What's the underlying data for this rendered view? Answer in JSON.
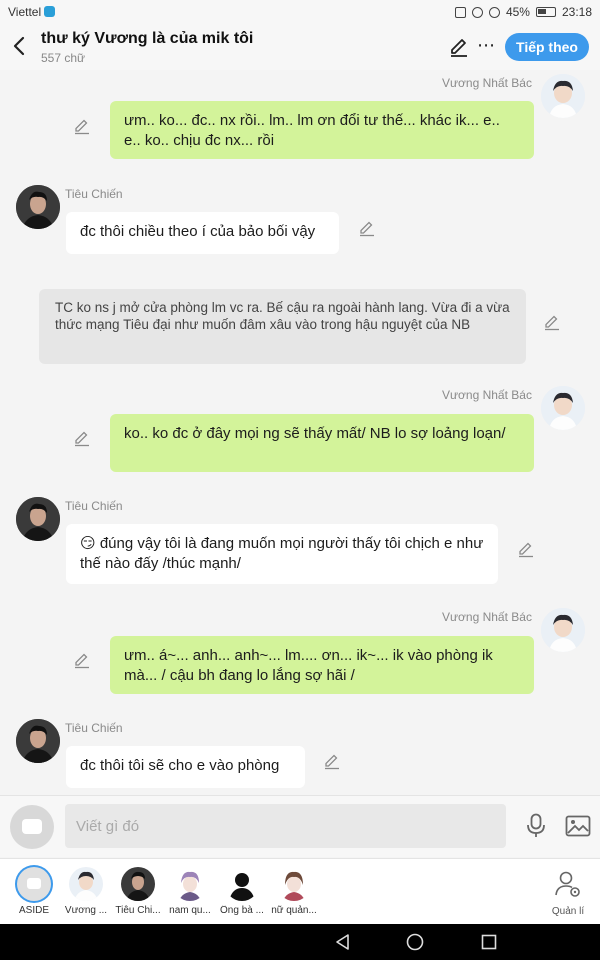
{
  "status_bar": {
    "carrier": "Viettel",
    "battery": "45%",
    "time": "23:18"
  },
  "header": {
    "title": "thư ký Vương là của mik tôi",
    "subtitle": "557 chữ",
    "next_button": "Tiếp theo"
  },
  "messages": [
    {
      "sender": "Vương Nhất Bác",
      "side": "right",
      "text": "ưm.. ko... đc.. nx rồi.. lm.. lm ơn đổi tư thế... khác ik... e.. e.. ko.. chịu đc nx... rồi"
    },
    {
      "sender": "Tiêu Chiến",
      "side": "left",
      "text": "đc thôi chiều theo í của bảo bối vậy"
    },
    {
      "sender": "",
      "side": "center",
      "text": "TC ko ns j mở cửa phòng lm vc ra. Bế cậu ra ngoài hành lang. Vừa đi a vừa thức mạng Tiêu đại như muốn đâm xâu vào trong hậu nguyệt của NB"
    },
    {
      "sender": "Vương Nhất Bác",
      "side": "right",
      "text": "ko.. ko đc ở đây mọi ng sẽ thấy mất/ NB lo sợ loảng loạn/"
    },
    {
      "sender": "Tiêu Chiến",
      "side": "left",
      "emoji": "😏",
      "text": "đúng vậy tôi là  đang muốn mọi người thấy tôi chịch e như thế nào đấy /thúc mạnh/"
    },
    {
      "sender": "Vương Nhất Bác",
      "side": "right",
      "text": "ưm.. á~... anh... anh~... lm.... ơn... ik~... ik vào phòng ik mà... / cậu bh đang lo lắng sợ hãi /"
    },
    {
      "sender": "Tiêu Chiến",
      "side": "left",
      "text": "đc thôi tôi sẽ cho e vào phòng"
    }
  ],
  "input": {
    "placeholder": "Viết gì đó"
  },
  "characters": [
    {
      "label": "ASIDE"
    },
    {
      "label": "Vương ..."
    },
    {
      "label": "Tiêu Chi..."
    },
    {
      "label": "nam qu..."
    },
    {
      "label": "Ông bà ..."
    },
    {
      "label": "nữ quản..."
    }
  ],
  "manage_label": "Quản lí",
  "colors": {
    "accent": "#3d9aec",
    "bubble_self": "#d3f39a",
    "bubble_other": "#ffffff",
    "bubble_narration": "#e6e6e6"
  }
}
